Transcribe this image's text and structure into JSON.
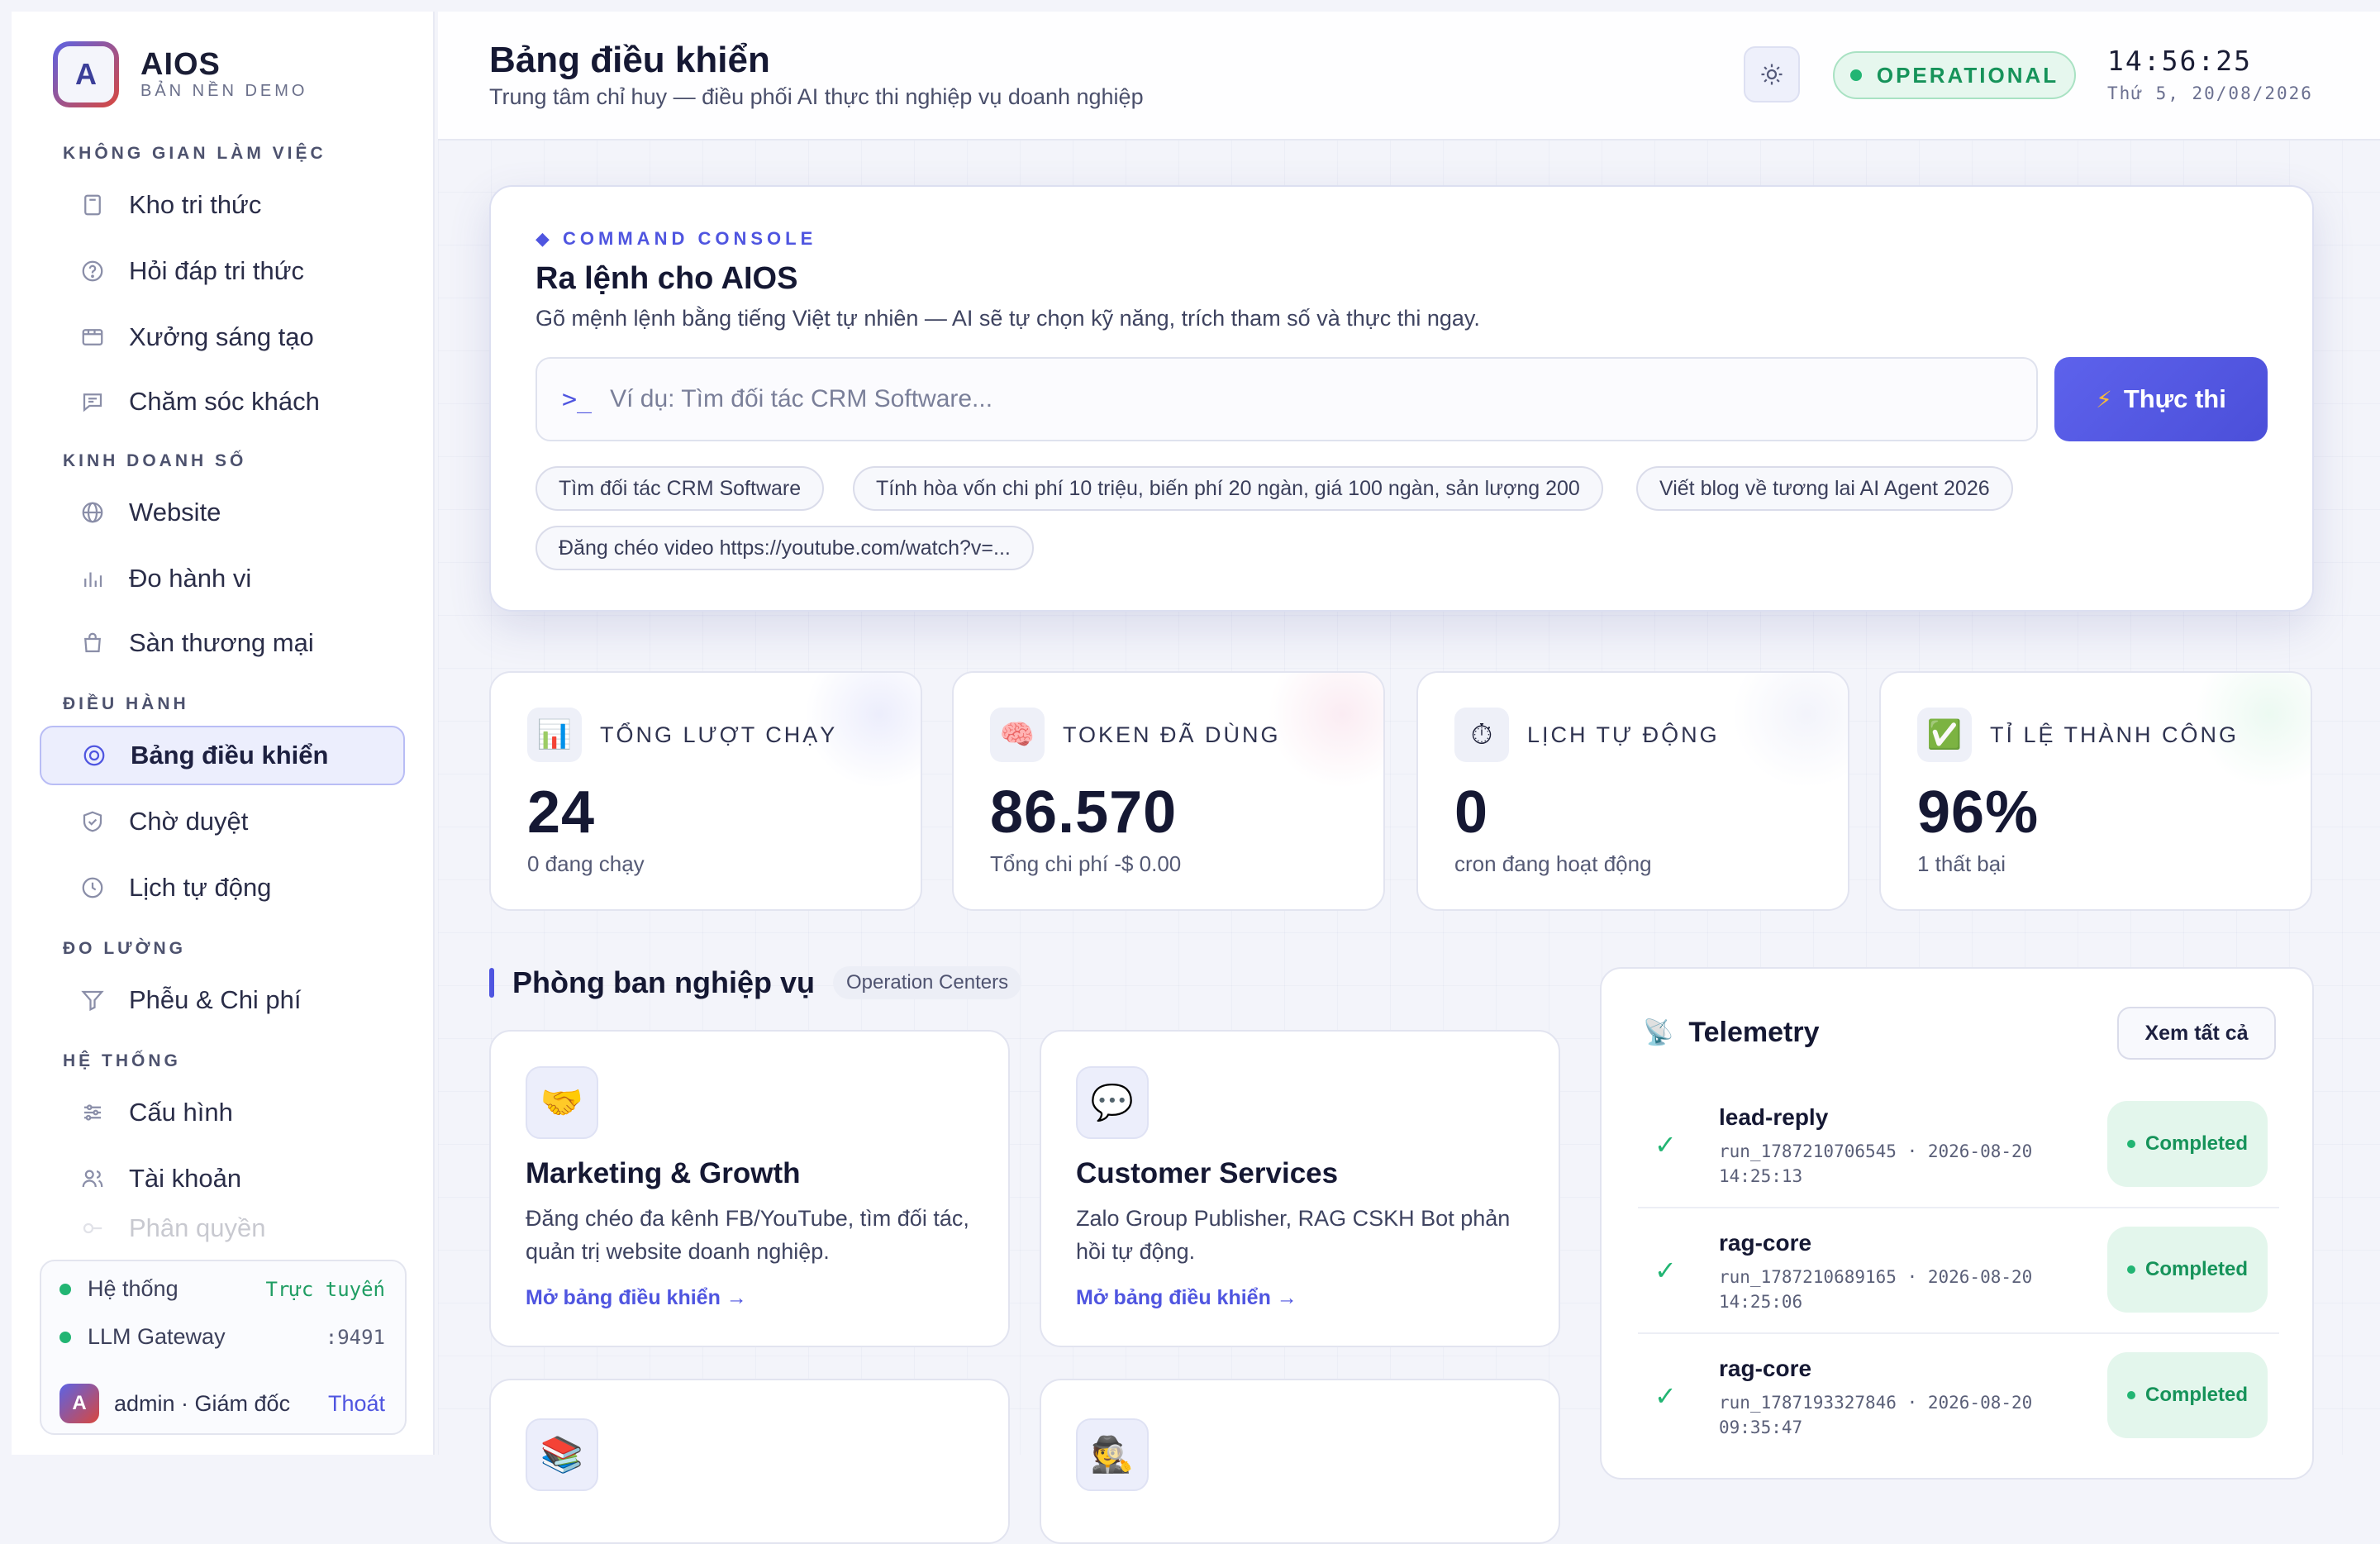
{
  "brand": {
    "logo_letter": "A",
    "name": "AIOS",
    "sub": "BẢN NỀN DEMO"
  },
  "sidebar": {
    "sections": [
      {
        "label": "KHÔNG GIAN LÀM VIỆC"
      },
      {
        "label": "KINH DOANH SỐ"
      },
      {
        "label": "ĐIỀU HÀNH"
      },
      {
        "label": "ĐO LƯỜNG"
      },
      {
        "label": "HỆ THỐNG"
      }
    ],
    "items": [
      {
        "label": "Kho tri thức",
        "icon": "book-icon"
      },
      {
        "label": "Hỏi đáp tri thức",
        "icon": "help-circle-icon"
      },
      {
        "label": "Xưởng sáng tạo",
        "icon": "film-icon"
      },
      {
        "label": "Chăm sóc khách",
        "icon": "chat-icon"
      },
      {
        "label": "Website",
        "icon": "globe-icon"
      },
      {
        "label": "Đo hành vi",
        "icon": "bar-chart-icon"
      },
      {
        "label": "Sàn thương mại",
        "icon": "shopping-bag-icon"
      },
      {
        "label": "Bảng điều khiển",
        "icon": "dashboard-icon",
        "active": true
      },
      {
        "label": "Chờ duyệt",
        "icon": "shield-check-icon"
      },
      {
        "label": "Lịch tự động",
        "icon": "clock-icon"
      },
      {
        "label": "Phễu & Chi phí",
        "icon": "funnel-icon"
      },
      {
        "label": "Cấu hình",
        "icon": "sliders-icon"
      },
      {
        "label": "Tài khoản",
        "icon": "users-icon"
      },
      {
        "label": "Phân quyền",
        "icon": "key-icon"
      }
    ],
    "status": {
      "system_label": "Hệ thống",
      "system_value": "Trực tuyến",
      "gateway_label": "LLM Gateway",
      "gateway_value": ":9491",
      "user_initial": "A",
      "user_name": "admin · Giám đốc",
      "logout": "Thoát"
    }
  },
  "header": {
    "title": "Bảng điều khiển",
    "subtitle": "Trung tâm chỉ huy — điều phối AI thực thi nghiệp vụ doanh nghiệp",
    "status": "OPERATIONAL",
    "time": "14:56:25",
    "date": "Thứ 5, 20/08/2026"
  },
  "console": {
    "kicker": "COMMAND CONSOLE",
    "title": "Ra lệnh cho AIOS",
    "description": "Gõ mệnh lệnh bằng tiếng Việt tự nhiên — AI sẽ tự chọn kỹ năng, trích tham số và thực thi ngay.",
    "prompt": ">_",
    "placeholder": "Ví dụ: Tìm đối tác CRM Software...",
    "execute_label": "Thực thi",
    "suggestions": [
      "Tìm đối tác CRM Software",
      "Tính hòa vốn chi phí 10 triệu, biến phí 20 ngàn, giá 100 ngàn, sản lượng 200",
      "Viết blog về tương lai AI Agent 2026",
      "Đăng chéo video https://youtube.com/watch?v=..."
    ]
  },
  "stats": [
    {
      "label": "TỔNG LƯỢT CHẠY",
      "value": "24",
      "sub": "0  đang chạy",
      "icon": "chart-icon",
      "glow": "#c9cdf7"
    },
    {
      "label": "TOKEN ĐÃ DÙNG",
      "value": "86.570",
      "sub": "Tổng chi phí -$ 0.00",
      "icon": "brain-icon",
      "glow": "#f3c9dc"
    },
    {
      "label": "LỊCH TỰ ĐỘNG",
      "value": "0",
      "sub": "cron đang hoạt động",
      "icon": "stopwatch-icon",
      "glow": "#dcdff3"
    },
    {
      "label": "TỈ LỆ THÀNH CÔNG",
      "value": "96%",
      "sub": "1  thất bại",
      "icon": "check-box-icon",
      "glow": "#c9efd9"
    }
  ],
  "departments": {
    "title": "Phòng ban nghiệp vụ",
    "tag": "Operation Centers",
    "cards": [
      {
        "name": "Marketing & Growth",
        "desc": "Đăng chéo đa kênh FB/YouTube, tìm đối tác, quản trị website doanh nghiệp.",
        "link": "Mở bảng điều khiển →",
        "icon": "handshake-icon"
      },
      {
        "name": "Customer Services",
        "desc": "Zalo Group Publisher, RAG CSKH Bot phản hồi tự động.",
        "link": "Mở bảng điều khiển →",
        "icon": "speech-bubble-icon"
      }
    ]
  },
  "telemetry": {
    "title": "Telemetry",
    "view_all": "Xem tất cả",
    "runs": [
      {
        "name": "lead-reply",
        "meta": "run_1787210706545 · 2026-08-20 14:25:13",
        "status": "Completed"
      },
      {
        "name": "rag-core",
        "meta": "run_1787210689165 · 2026-08-20 14:25:06",
        "status": "Completed"
      },
      {
        "name": "rag-core",
        "meta": "run_1787193327846 · 2026-08-20 09:35:47",
        "status": "Completed"
      }
    ]
  }
}
